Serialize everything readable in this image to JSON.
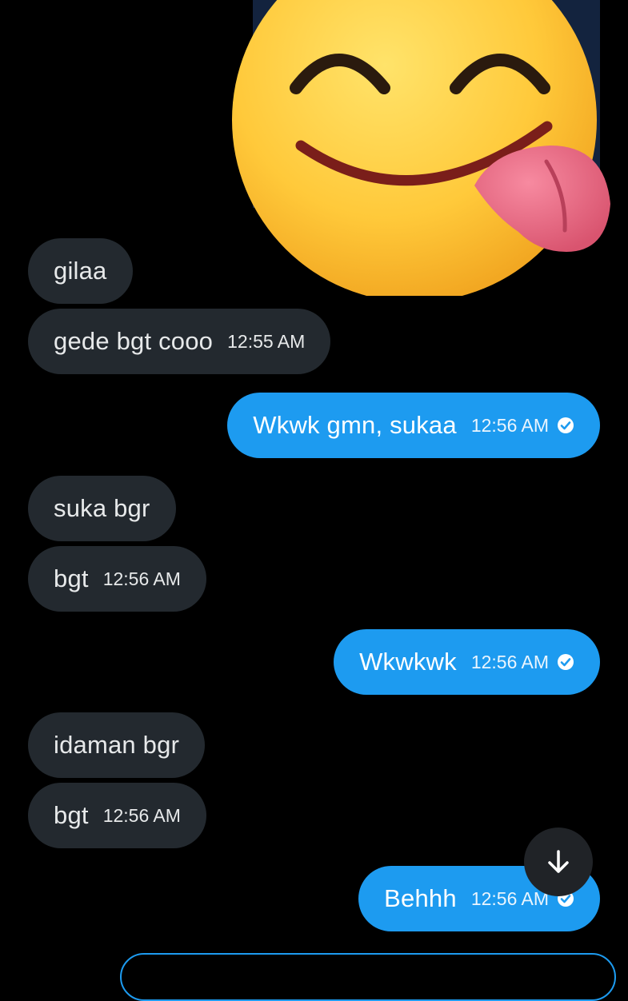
{
  "messages": [
    {
      "side": "in",
      "text": "gilaa",
      "time": ""
    },
    {
      "side": "in",
      "text": "gede bgt cooo",
      "time": "12:55 AM"
    },
    {
      "side": "out",
      "text": "Wkwk gmn, sukaa",
      "time": "12:56 AM"
    },
    {
      "side": "in",
      "text": "suka bgr",
      "time": ""
    },
    {
      "side": "in",
      "text": "bgt",
      "time": "12:56 AM"
    },
    {
      "side": "out",
      "text": "Wkwkwk",
      "time": "12:56 AM"
    },
    {
      "side": "in",
      "text": "idaman bgr",
      "time": ""
    },
    {
      "side": "in",
      "text": "bgt",
      "time": "12:56 AM"
    },
    {
      "side": "out",
      "text": "Behhh",
      "time": "12:56 AM"
    }
  ],
  "icons": {
    "sticker": "yum-tongue-emoji-sticker",
    "read_receipt": "check-circle-icon",
    "scroll_down": "arrow-down-icon"
  },
  "colors": {
    "background": "#000000",
    "incoming_bubble": "#23292f",
    "outgoing_bubble": "#1d9bf0",
    "scroll_button": "#202327"
  }
}
